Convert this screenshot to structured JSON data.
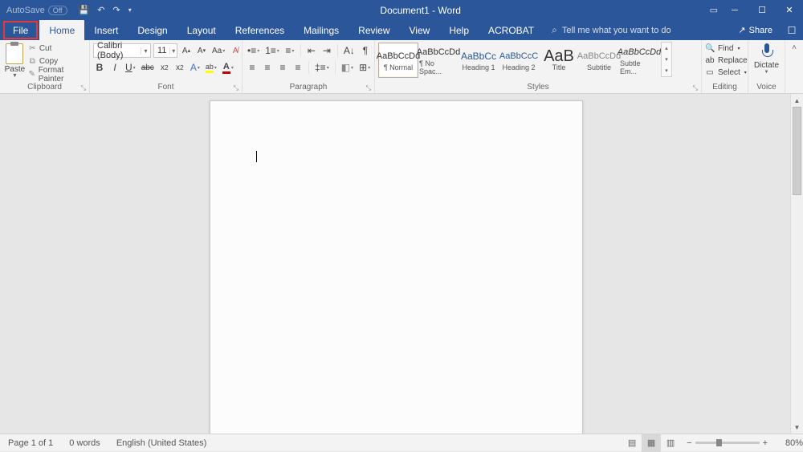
{
  "titlebar": {
    "autosave_label": "AutoSave",
    "autosave_state": "Off",
    "title": "Document1 - Word"
  },
  "tabs": {
    "file": "File",
    "home": "Home",
    "insert": "Insert",
    "design": "Design",
    "layout": "Layout",
    "references": "References",
    "mailings": "Mailings",
    "review": "Review",
    "view": "View",
    "help": "Help",
    "acrobat": "ACROBAT",
    "tellme_placeholder": "Tell me what you want to do",
    "share": "Share"
  },
  "ribbon": {
    "clipboard": {
      "label": "Clipboard",
      "paste": "Paste",
      "cut": "Cut",
      "copy": "Copy",
      "format_painter": "Format Painter"
    },
    "font": {
      "label": "Font",
      "name": "Calibri (Body)",
      "size": "11"
    },
    "paragraph": {
      "label": "Paragraph"
    },
    "styles": {
      "label": "Styles",
      "items": [
        {
          "preview": "AaBbCcDd",
          "name": "¶ Normal"
        },
        {
          "preview": "AaBbCcDd",
          "name": "¶ No Spac..."
        },
        {
          "preview": "AaBbCc",
          "name": "Heading 1"
        },
        {
          "preview": "AaBbCcC",
          "name": "Heading 2"
        },
        {
          "preview": "AaB",
          "name": "Title"
        },
        {
          "preview": "AaBbCcDd",
          "name": "Subtitle"
        },
        {
          "preview": "AaBbCcDd",
          "name": "Subtle Em..."
        }
      ]
    },
    "editing": {
      "label": "Editing",
      "find": "Find",
      "replace": "Replace",
      "select": "Select"
    },
    "voice": {
      "label": "Voice",
      "dictate": "Dictate"
    }
  },
  "statusbar": {
    "page": "Page 1 of 1",
    "words": "0 words",
    "language": "English (United States)",
    "zoom": "80%"
  }
}
